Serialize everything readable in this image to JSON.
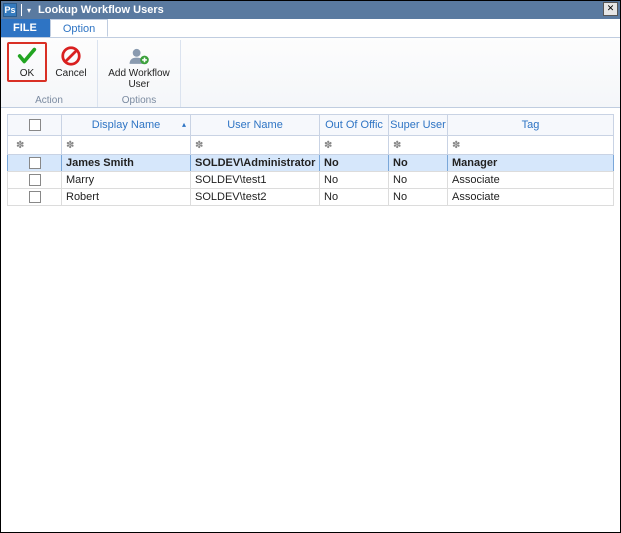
{
  "titlebar": {
    "title": "Lookup Workflow Users",
    "appGlyph": "Ps"
  },
  "tabs": {
    "file": "FILE",
    "option": "Option"
  },
  "ribbon": {
    "ok": "OK",
    "cancel": "Cancel",
    "addWorkflowUser": "Add Workflow User",
    "groupAction": "Action",
    "groupOptions": "Options"
  },
  "grid": {
    "columns": {
      "displayName": "Display Name",
      "userName": "User Name",
      "outOfOffice": "Out Of Offic",
      "superUser": "Super User",
      "tag": "Tag"
    },
    "rows": [
      {
        "display": "James Smith",
        "user": "SOLDEV\\Administrator",
        "oof": "No",
        "su": "No",
        "tag": "Manager",
        "selected": true
      },
      {
        "display": "Marry",
        "user": "SOLDEV\\test1",
        "oof": "No",
        "su": "No",
        "tag": "Associate",
        "selected": false
      },
      {
        "display": "Robert",
        "user": "SOLDEV\\test2",
        "oof": "No",
        "su": "No",
        "tag": "Associate",
        "selected": false
      }
    ]
  }
}
